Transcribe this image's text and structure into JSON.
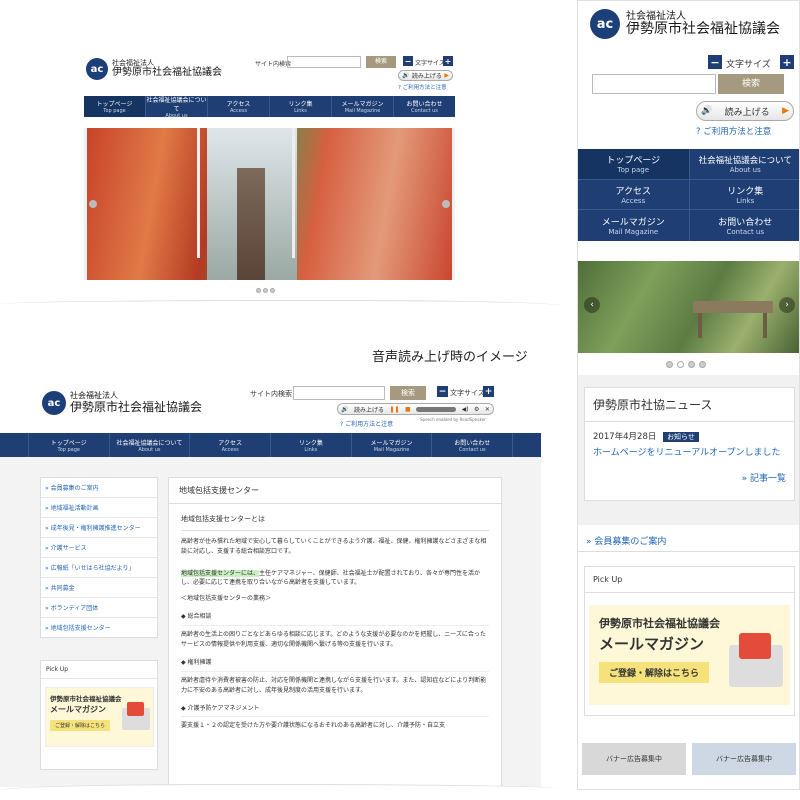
{
  "logo": {
    "line1": "社会福祉法人",
    "line2": "伊勢原市社会福祉協議会",
    "mark": "ac"
  },
  "header": {
    "search_label": "サイト内検索",
    "search_button": "検索",
    "font_size_label": "文字サイズ",
    "minus": "−",
    "plus": "+",
    "read_button": "読み上げる",
    "usage_link": "ご利用方法と注意"
  },
  "nav": [
    {
      "jp": "トップページ",
      "en": "Top page"
    },
    {
      "jp": "社会福祉協議会について",
      "en": "About us"
    },
    {
      "jp": "アクセス",
      "en": "Access"
    },
    {
      "jp": "リンク集",
      "en": "Links"
    },
    {
      "jp": "メールマガジン",
      "en": "Mail Magazine"
    },
    {
      "jp": "お問い合わせ",
      "en": "Contact us"
    }
  ],
  "caption": "音声読み上げ時のイメージ",
  "player": {
    "enabled_by": "Speech enabled by ReadSpeaker"
  },
  "sidebar": {
    "items": [
      "会員募集のご案内",
      "地域福祉活動計画",
      "成年後見・権利擁護推進センター",
      "介護サービス",
      "広報紙「いせはら社協だより」",
      "共同募金",
      "ボランティア団体",
      "地域包括支援センター"
    ],
    "pickup": "Pick Up",
    "banner_line1": "伊勢原市社会福祉協議会",
    "banner_line2": "メールマガジン",
    "banner_cta": "ご登録・解除はこちら"
  },
  "content": {
    "heading": "地域包括支援センター",
    "subheading": "地域包括支援センターとは",
    "para1": "高齢者が住み慣れた地域で安心して暮らしていくことができるよう介護、福祉、保健、権利擁護などさまざまな相談に対応し、支援する総合相談窓口です。",
    "para2_highlight": "地域包括支援センターには、",
    "para2_rest": "主任ケアマネジャー、保健師、社会福祉士が配置されており、各々が専門性を活かし、必要に応じて連携を取り合いながら高齢者を支援しています。",
    "duties": "＜地域包括支援センターの業務＞",
    "s1_title": "総合相談",
    "s1_text": "高齢者の生活上の困りごとなどあらゆる相談に応じます。どのような支援が必要なのかを把握し、ニーズに合ったサービスの情報提供や利用支援、適切な関係機関へ繋げる等の支援を行います。",
    "s2_title": "権利擁護",
    "s2_text": "高齢者虐待や消費者被害の防止、対応を関係機関と連携しながら支援を行います。また、認知症などにより判断能力に不安のある高齢者に対し、成年後見制度の活用支援を行います。",
    "s3_title": "介護予防ケアマネジメント",
    "s3_text": "要支援１・２の認定を受けた方や要介護状態になるおそれのある高齢者に対し、介護予防・自立支"
  },
  "mobile": {
    "news_title": "伊勢原市社協ニュース",
    "news_date": "2017年4月28日",
    "news_badge": "お知らせ",
    "news_text": "ホームページをリニューアルオープンしました",
    "news_more": "記事一覧",
    "member_link": "会員募集のご案内",
    "banner_ad1": "バナー広告募集中",
    "banner_ad2": "バナー広告募集中"
  },
  "colors": {
    "navy": "#1f3f74",
    "tan": "#a59a7f",
    "orange": "#e8780a",
    "highlight": "#c9f0c0"
  }
}
